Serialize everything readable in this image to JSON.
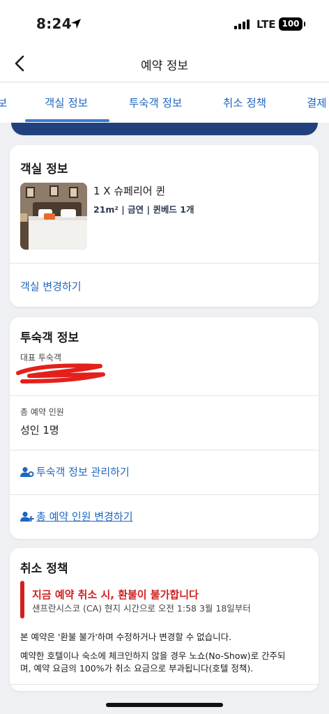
{
  "status_bar": {
    "time": "8:24",
    "network": "LTE",
    "battery": "100"
  },
  "header": {
    "title": "예약 정보"
  },
  "tabs": [
    {
      "label": "호텔 정보",
      "visible_fragment": "보"
    },
    {
      "label": "객실 정보"
    },
    {
      "label": "투숙객 정보"
    },
    {
      "label": "취소 정책"
    },
    {
      "label": "결제"
    }
  ],
  "room_card": {
    "title": "객실 정보",
    "room_name": "1 X 슈페리어 퀸",
    "room_meta": "21m² | 금연 | 퀸베드 1개",
    "change_link": "객실 변경하기"
  },
  "guest_card": {
    "title": "투숙객 정보",
    "lead_label": "대표 투숙객",
    "total_label": "총 예약 인원",
    "total_value": "성인 1명",
    "manage_link": "투숙객 정보 관리하기",
    "change_count_link": "총 예약 인원 변경하기"
  },
  "policy_card": {
    "title": "취소 정책",
    "alert": "지금 예약 취소 시, 환불이 불가합니다",
    "time_note": "샌프란시스코 (CA) 현지 시간으로 오전 1:58 3월 18일부터",
    "line1": "본 예약은 '환불 불가'하며 수정하거나 변경할 수 없습니다.",
    "line2": "예약한 호텔이나 숙소에 체크인하지 않을 경우 노쇼(No-Show)로 간주되",
    "line3": "며, 예약 요금의 100%가 취소 요금으로 부과됩니다(호텔 정책)."
  },
  "colors": {
    "accent": "#1d66c3",
    "alert": "#d32020",
    "banner": "#22407d",
    "redaction": "#e4201b"
  }
}
